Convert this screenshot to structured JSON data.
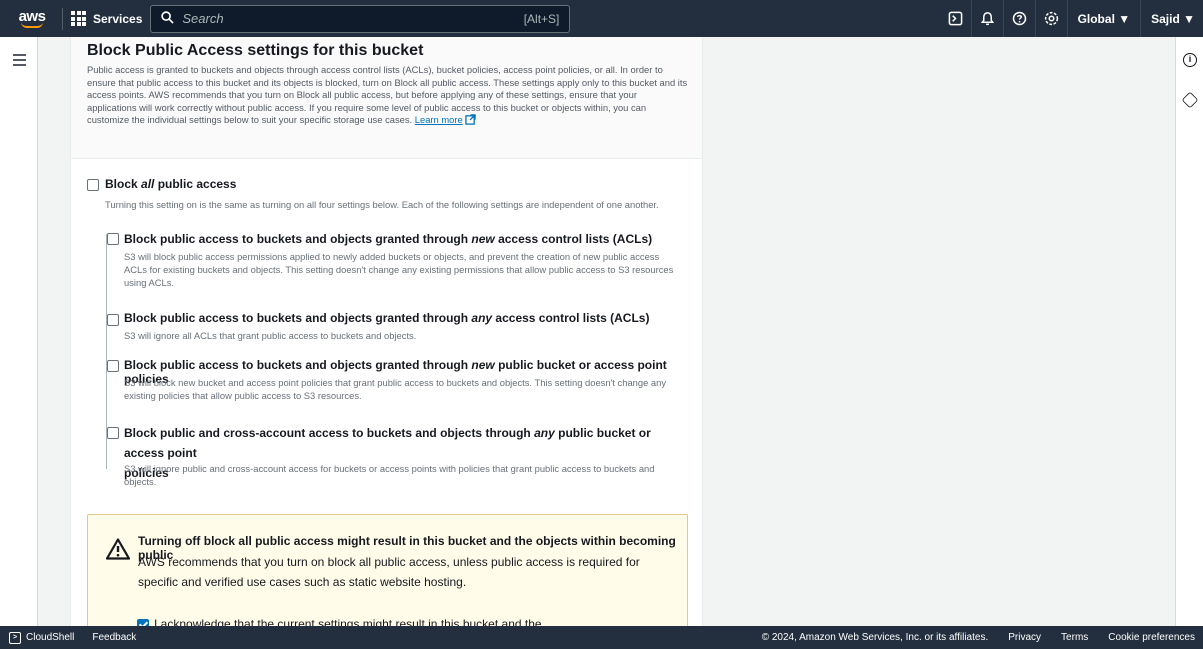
{
  "nav": {
    "logo": "aws",
    "services_label": "Services",
    "search_placeholder": "Search",
    "search_shortcut": "[Alt+S]",
    "region": "Global ▼",
    "user": "Sajid ▼",
    "icons": [
      "cloudshell-icon",
      "bell-icon",
      "help-icon",
      "settings-icon"
    ]
  },
  "section": {
    "title": "Block Public Access settings for this bucket",
    "description": "Public access is granted to buckets and objects through access control lists (ACLs), bucket policies, access point policies, or all. In order to ensure that public access to this bucket and its objects is blocked, turn on Block all public access. These settings apply only to this bucket and its access points. AWS recommends that you turn on Block all public access, but before applying any of these settings, ensure that your applications will work correctly without public access. If you require some level of public access to this bucket or objects within, you can customize the individual settings below to suit your specific storage use cases.",
    "learn_more": "Learn more"
  },
  "block_all": {
    "label_pre": "Block ",
    "label_em": "all",
    "label_post": " public access",
    "description": "Turning this setting on is the same as turning on all four settings below. Each of the following settings are independent of one another.",
    "checked": false
  },
  "options": [
    {
      "label_pre": "Block public access to buckets and objects granted through ",
      "label_em": "new",
      "label_post": " access control lists (ACLs)",
      "description": "S3 will block public access permissions applied to newly added buckets or objects, and prevent the creation of new public access ACLs for existing buckets and objects. This setting doesn't change any existing permissions that allow public access to S3 resources using ACLs.",
      "checked": false
    },
    {
      "label_pre": "Block public access to buckets and objects granted through ",
      "label_em": "any",
      "label_post": " access control lists (ACLs)",
      "description": "S3 will ignore all ACLs that grant public access to buckets and objects.",
      "checked": false
    },
    {
      "label_pre": "Block public access to buckets and objects granted through ",
      "label_em": "new",
      "label_post": " public bucket or access point policies",
      "description": "S3 will block new bucket and access point policies that grant public access to buckets and objects. This setting doesn't change any existing policies that allow public access to S3 resources.",
      "checked": false
    },
    {
      "label_pre": "Block public and cross-account access to buckets and objects through ",
      "label_em": "any",
      "label_post": " public bucket or access point",
      "label_line2": "policies",
      "description": "S3 will ignore public and cross-account access for buckets or access points with policies that grant public access to buckets and objects.",
      "checked": false
    }
  ],
  "warning": {
    "title": "Turning off block all public access might result in this bucket and the objects within becoming public",
    "body": "AWS recommends that you turn on block all public access, unless public access is required for specific and verified use cases such as static website hosting.",
    "ack_label": "I acknowledge that the current settings might result in this bucket and the",
    "ack_checked": true
  },
  "footer": {
    "cloudshell": "CloudShell",
    "feedback": "Feedback",
    "copyright": "© 2024, Amazon Web Services, Inc. or its affiliates.",
    "privacy": "Privacy",
    "terms": "Terms",
    "cookies": "Cookie preferences"
  }
}
